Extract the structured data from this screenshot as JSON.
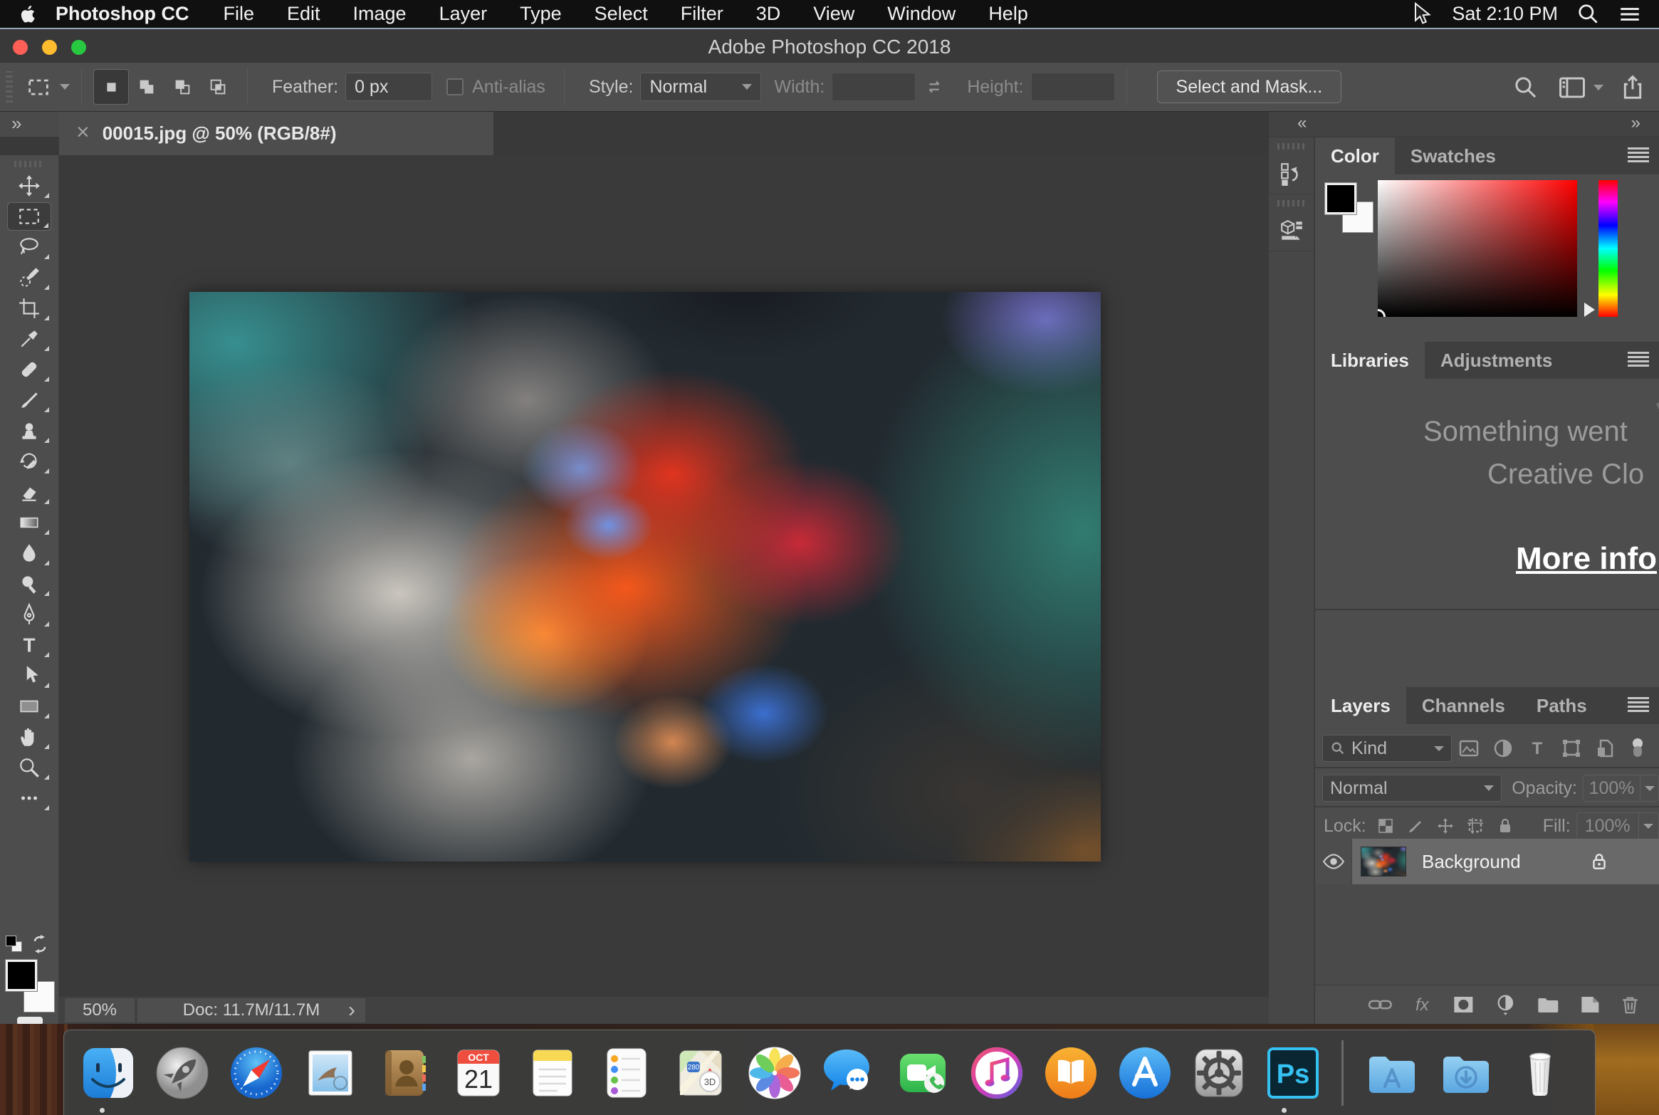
{
  "menu_bar": {
    "app_name": "Photoshop CC",
    "items": [
      "File",
      "Edit",
      "Image",
      "Layer",
      "Type",
      "Select",
      "Filter",
      "3D",
      "View",
      "Window",
      "Help"
    ],
    "clock": "Sat 2:10 PM"
  },
  "window": {
    "title": "Adobe Photoshop CC 2018"
  },
  "options_bar": {
    "feather_label": "Feather:",
    "feather_value": "0 px",
    "anti_alias_label": "Anti-alias",
    "style_label": "Style:",
    "style_value": "Normal",
    "width_label": "Width:",
    "height_label": "Height:",
    "select_and_mask_label": "Select and Mask..."
  },
  "document": {
    "tab_title": "00015.jpg @ 50% (RGB/8#)",
    "close_glyph": "×",
    "zoom_level": "50%",
    "doc_size": "Doc: 11.7M/11.7M",
    "status_chevron": "›",
    "expand_glyph": "»"
  },
  "toolbar_tools": [
    "move",
    "rectangular-marquee",
    "lasso",
    "quick-selection",
    "crop",
    "eyedropper",
    "spot-healing-brush",
    "brush",
    "clone-stamp",
    "history-brush",
    "eraser",
    "gradient",
    "blur",
    "dodge",
    "pen",
    "type",
    "path-selection",
    "rectangle",
    "hand",
    "zoom",
    "edit-toolbar"
  ],
  "panels": {
    "collapse_left": "«",
    "collapse_right": "»",
    "color": {
      "tabs": [
        "Color",
        "Swatches"
      ],
      "active_tab": "Color"
    },
    "libraries": {
      "tabs": [
        "Libraries",
        "Adjustments"
      ],
      "active_tab": "Libraries",
      "message_line1": "Something went",
      "message_line2": "Creative Clo",
      "link_text": "More info"
    },
    "layers": {
      "tabs": [
        "Layers",
        "Channels",
        "Paths"
      ],
      "active_tab": "Layers",
      "filter_label": "Kind",
      "blend_mode": "Normal",
      "opacity_label": "Opacity:",
      "opacity_value": "100%",
      "lock_label": "Lock:",
      "fill_label": "Fill:",
      "fill_value": "100%",
      "layer_name": "Background"
    }
  },
  "dock": {
    "apps": [
      "Finder",
      "Launchpad",
      "Safari",
      "Mail",
      "Contacts",
      "Calendar",
      "Notes",
      "Reminders",
      "Maps",
      "Photos",
      "Messages",
      "FaceTime",
      "iTunes",
      "Books",
      "App Store",
      "System Preferences",
      "Photoshop",
      "Applications",
      "Downloads",
      "Trash"
    ],
    "calendar_month": "OCT",
    "calendar_day": "21",
    "maps_badge": "3D",
    "maps_route": "280",
    "photoshop_glyph": "Ps"
  },
  "colors": {
    "accent_cyan": "#35c1f1",
    "traffic_red": "#ff5f57",
    "traffic_yellow": "#febc2e",
    "traffic_green": "#28c840",
    "panel_bg": "#4d4d4d",
    "pasteboard_bg": "#3a3a3a",
    "selected_row_bg": "#696969"
  }
}
